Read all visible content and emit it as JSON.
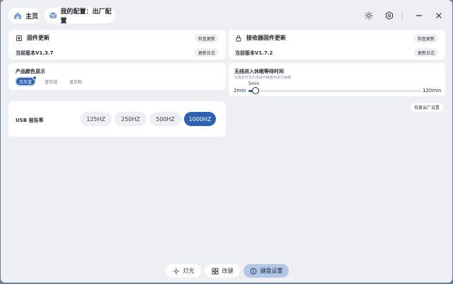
{
  "header": {
    "home_label": "主页",
    "config_label": "我的配置：出厂配置"
  },
  "firmware": {
    "title": "固件更新",
    "check_label": "检查更新",
    "version": "当前版本V1.3.7",
    "log_label": "更新日志"
  },
  "receiver": {
    "title": "接收器固件更新",
    "check_label": "检查更新",
    "version": "当前版本V1.7.2",
    "log_label": "更新日志"
  },
  "color": {
    "title": "产品颜色显示",
    "options": [
      "白灰蓝",
      "蓝灰绿",
      "蓝灰粉"
    ],
    "selected": "白灰蓝"
  },
  "sleep": {
    "title": "无线进入休眠等待时间",
    "subtitle": "在指定时长内未操作键盘将进行休眠",
    "min_label": "2min",
    "max_label": "120min",
    "value_label": "5min",
    "value": 5,
    "min": 2,
    "max": 120
  },
  "reset_label": "恢复出厂设置",
  "usb": {
    "title": "USB 报告率",
    "options": [
      "125HZ",
      "250HZ",
      "500HZ",
      "1000HZ"
    ],
    "selected": "1000HZ"
  },
  "bottom_tabs": [
    "灯光",
    "改键",
    "键盘设置"
  ],
  "active_tab": "键盘设置",
  "colors": {
    "accent": "#2d62b3",
    "background": "#eeeff2",
    "card": "#ffffff"
  },
  "icons": {
    "home": "home-icon",
    "config": "cube-icon",
    "brightness": "sun-icon",
    "settings": "hexagon-gear-icon",
    "minimize": "minus-icon",
    "close": "close-icon",
    "firmware": "chip-icon",
    "receiver": "lock-icon",
    "light": "sun-icon",
    "keymap": "grid-icon",
    "keyboard": "info-icon"
  }
}
